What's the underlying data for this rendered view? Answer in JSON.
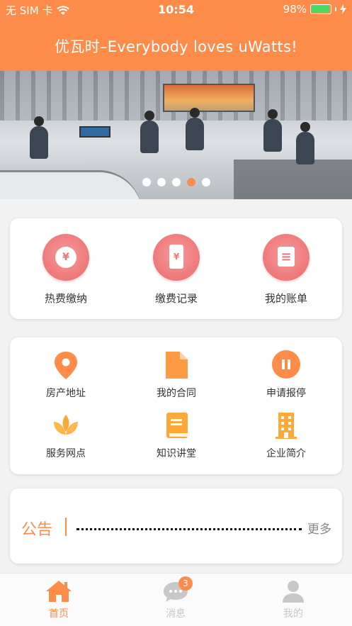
{
  "status_bar": {
    "carrier": "无 SIM 卡",
    "time": "10:54",
    "battery": "98%",
    "battery_level": 0.98
  },
  "header": {
    "title": "优瓦时–Everybody loves uWatts!"
  },
  "banner": {
    "slide_count": 5,
    "active_index": 3
  },
  "payment_card": {
    "items": [
      {
        "label": "热费缴纳",
        "icon": "yen-coin-icon",
        "glyph": "¥"
      },
      {
        "label": "缴费记录",
        "icon": "receipt-icon",
        "glyph": "¥"
      },
      {
        "label": "我的账单",
        "icon": "bill-icon",
        "glyph": "≡"
      }
    ]
  },
  "services_card": {
    "items": [
      {
        "label": "房产地址",
        "icon": "location-pin-icon"
      },
      {
        "label": "我的合同",
        "icon": "document-icon"
      },
      {
        "label": "申请报停",
        "icon": "pause-icon"
      },
      {
        "label": "服务网点",
        "icon": "lotus-icon"
      },
      {
        "label": "知识讲堂",
        "icon": "book-icon"
      },
      {
        "label": "企业简介",
        "icon": "building-icon"
      }
    ]
  },
  "notice": {
    "title": "公告",
    "more": "更多"
  },
  "tabbar": {
    "tabs": [
      {
        "label": "首页",
        "icon": "home-icon",
        "active": true
      },
      {
        "label": "消息",
        "icon": "chat-icon",
        "badge": "3"
      },
      {
        "label": "我的",
        "icon": "user-icon"
      }
    ]
  },
  "colors": {
    "accent": "#fd8c4b",
    "pink": "#ee7878",
    "tab_inactive": "#c8c8c8"
  }
}
